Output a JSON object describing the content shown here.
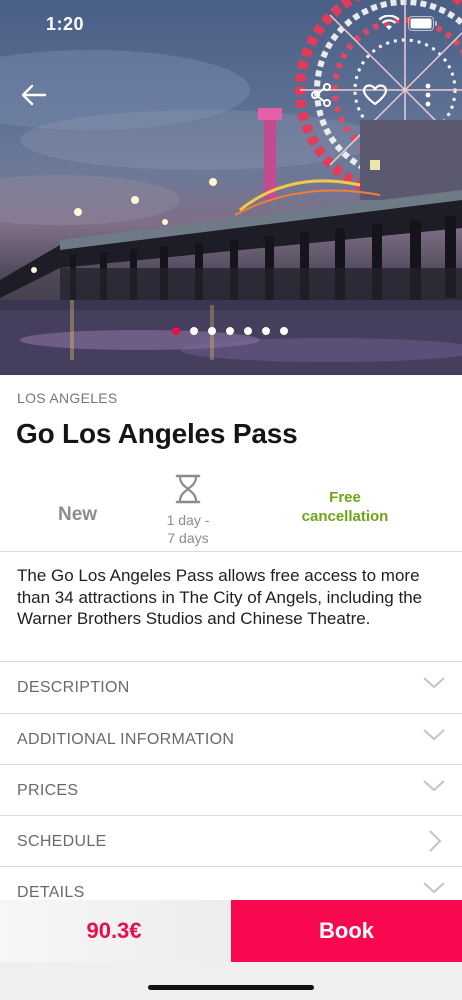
{
  "status": {
    "time": "1:20"
  },
  "hero": {
    "icons": [
      "back-arrow-icon",
      "share-icon",
      "heart-icon",
      "more-vertical-icon"
    ],
    "carousel": {
      "count": 7,
      "active_index": 0
    }
  },
  "product": {
    "city": "LOS ANGELES",
    "title": "Go Los Angeles Pass",
    "badge_new": "New",
    "duration_line1": "1 day -",
    "duration_line2": "7 days",
    "cancellation_line1": "Free",
    "cancellation_line2": "cancellation",
    "summary": "The Go Los Angeles Pass allows free access to more than 34 attractions in The City of Angels, including the Warner Brothers Studios and Chinese Theatre."
  },
  "sections": [
    {
      "label": "DESCRIPTION",
      "icon": "chevron-down-icon"
    },
    {
      "label": "ADDITIONAL INFORMATION",
      "icon": "chevron-down-icon"
    },
    {
      "label": "PRICES",
      "icon": "chevron-down-icon"
    },
    {
      "label": "SCHEDULE",
      "icon": "chevron-right-icon"
    },
    {
      "label": "DETAILS",
      "icon": "chevron-down-icon"
    }
  ],
  "footer": {
    "price": "90.3€",
    "book_label": "Book"
  },
  "colors": {
    "accent": "#f8084f",
    "price": "#e6104b",
    "cancellation": "#6da517",
    "active_dot": "#e6104b"
  }
}
